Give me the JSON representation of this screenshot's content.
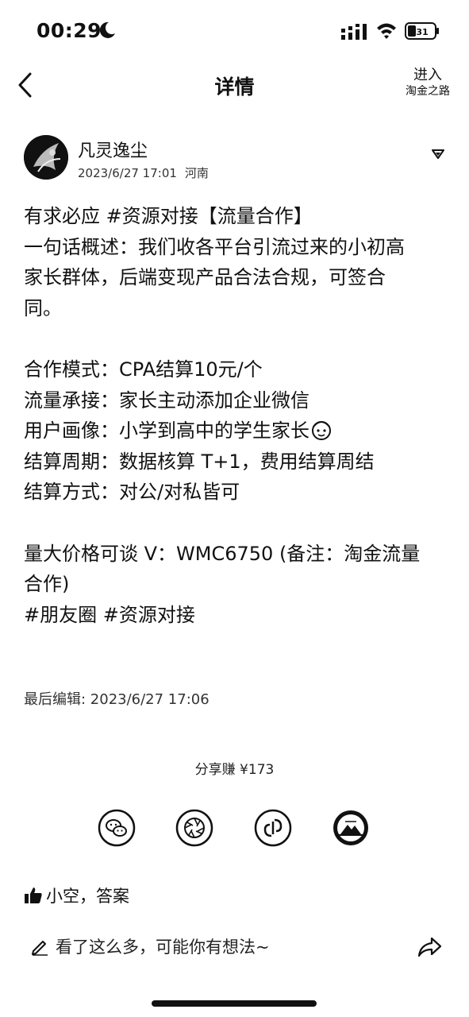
{
  "status_bar": {
    "time": "00:29",
    "battery": "31"
  },
  "nav": {
    "title": "详情",
    "enter_main": "进入",
    "enter_sub": "淘金之路"
  },
  "author": {
    "name": "凡灵逸尘",
    "date": "2023/6/27 17:01",
    "location": "河南"
  },
  "post": {
    "lines": [
      " 有求必应  #资源对接【流量合作】",
      "一句话概述：我们收各平台引流过来的小初高",
      "家长群体，后端变现产品合法合规，可签合",
      "同。",
      "",
      "合作模式：CPA结算10元/个",
      "流量承接：家长主动添加企业微信",
      "用户画像：小学到高中的学生家长",
      "结算周期：数据核算 T+1，费用结算周结",
      "结算方式：对公/对私皆可",
      "",
      "量大价格可谈 V：WMC6750 (备注：淘金流量",
      "合作)",
      "#朋友圈 #资源对接"
    ]
  },
  "edited": "最后编辑: 2023/6/27 17:06",
  "share": {
    "earn": "分享赚 ¥173"
  },
  "likes": {
    "text": "小空，答案"
  },
  "comment": {
    "placeholder": "看了这么多，可能你有想法~"
  }
}
